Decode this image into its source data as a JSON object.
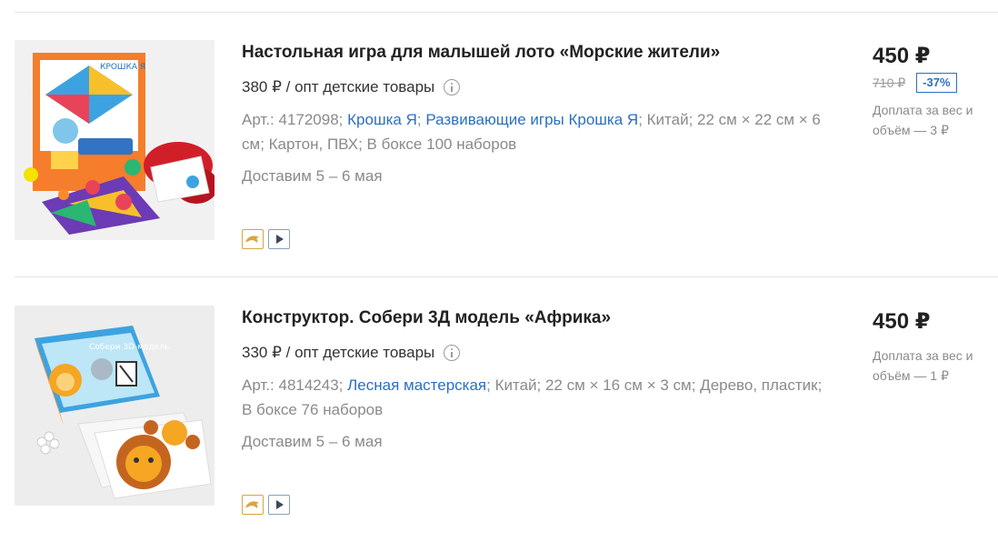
{
  "currency": "₽",
  "items": [
    {
      "title": "Настольная игра для малышей лото «Морские жители»",
      "wholesale_price": "380 ₽ / опт детские товары",
      "art_label": "Арт.: 4172098;",
      "brand_link": "Крошка Я",
      "sep1": ";",
      "series_link": "Развивающие игры Крошка Я",
      "specs_rest": "; Китай; 22 см × 22 см × 6 см; Картон, ПВХ; В боксе 100 наборов",
      "delivery": "Доставим 5 – 6 мая",
      "price": "450 ₽",
      "old_price": "710 ₽",
      "discount": "-37%",
      "surcharge": "Доплата за вес и объём — 3 ₽",
      "badges": [
        "dolphin-icon",
        "play-icon"
      ],
      "image": "box-lotto-sea-creatures"
    },
    {
      "title": "Конструктор. Собери 3Д модель «Африка»",
      "wholesale_price": "330 ₽ / опт детские товары",
      "art_label": "Арт.: 4814243;",
      "brand_link": "Лесная мастерская",
      "specs_rest": "; Китай; 22 см × 16 см × 3 см; Дерево, пластик; В боксе 76 наборов",
      "delivery": "Доставим 5 – 6 мая",
      "price": "450 ₽",
      "surcharge": "Доплата за вес и объём — 1 ₽",
      "badges": [
        "dolphin-icon",
        "play-icon"
      ],
      "image": "box-3d-model-africa"
    }
  ],
  "colors": {
    "link": "#2a6fc4",
    "muted": "#8a8a8a",
    "badge_gold": "#d9a441"
  }
}
